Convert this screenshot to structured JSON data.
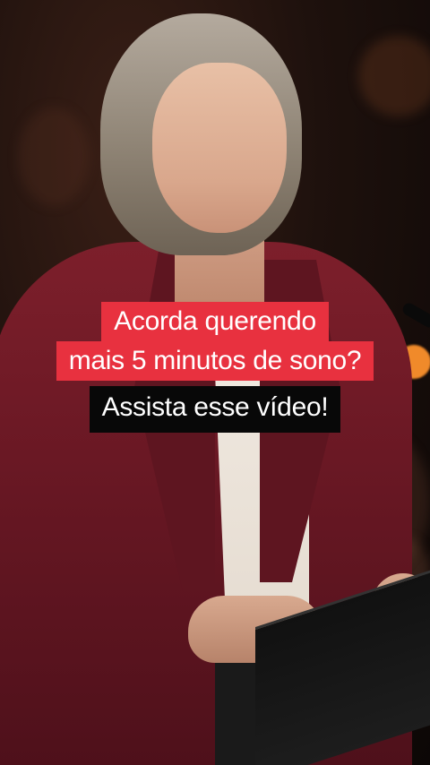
{
  "caption": {
    "line1": "Acorda querendo",
    "line2": "mais 5 minutos de sono?",
    "line3": "Assista esse vídeo!"
  },
  "colors": {
    "caption_red": "#e8313f",
    "caption_black": "#080808",
    "jacket": "#7d1f2b"
  }
}
